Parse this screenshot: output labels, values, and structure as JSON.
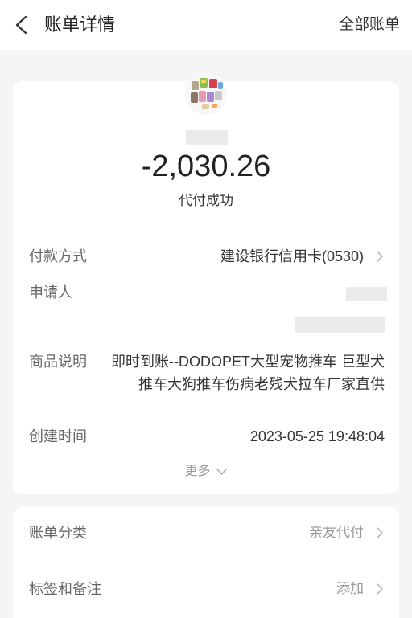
{
  "header": {
    "back_icon": "chevron-left-icon",
    "title": "账单详情",
    "right_link": "全部账单"
  },
  "summary": {
    "avatar_icon": "product-thumbnail-image",
    "amount": "-2,030.26",
    "status": "代付成功"
  },
  "details": {
    "payment_method": {
      "label": "付款方式",
      "value": "建设银行信用卡(0530)",
      "icon": "chevron-right-icon"
    },
    "applicant": {
      "label": "申请人"
    },
    "description": {
      "label": "商品说明",
      "lines": [
        "即时到账--DODOPET大型宠物推车 巨型犬",
        "推车大狗推车伤病老残犬拉车厂家直供"
      ]
    },
    "created_time": {
      "label": "创建时间",
      "value": "2023-05-25 19:48:04"
    },
    "more": {
      "label": "更多",
      "icon": "chevron-down-icon"
    }
  },
  "extra": {
    "category": {
      "label": "账单分类",
      "value": "亲友代付",
      "icon": "chevron-right-icon"
    },
    "tags": {
      "label": "标签和备注",
      "value": "添加",
      "icon": "chevron-right-icon"
    }
  },
  "colors": {
    "page_background": "#f5f5f5",
    "card_background": "#ffffff",
    "text_primary": "#222222",
    "text_value": "#333333",
    "text_secondary": "#666666",
    "text_muted": "#999999",
    "chevron": "#bbbbbb",
    "mask": "#ebebeb"
  }
}
